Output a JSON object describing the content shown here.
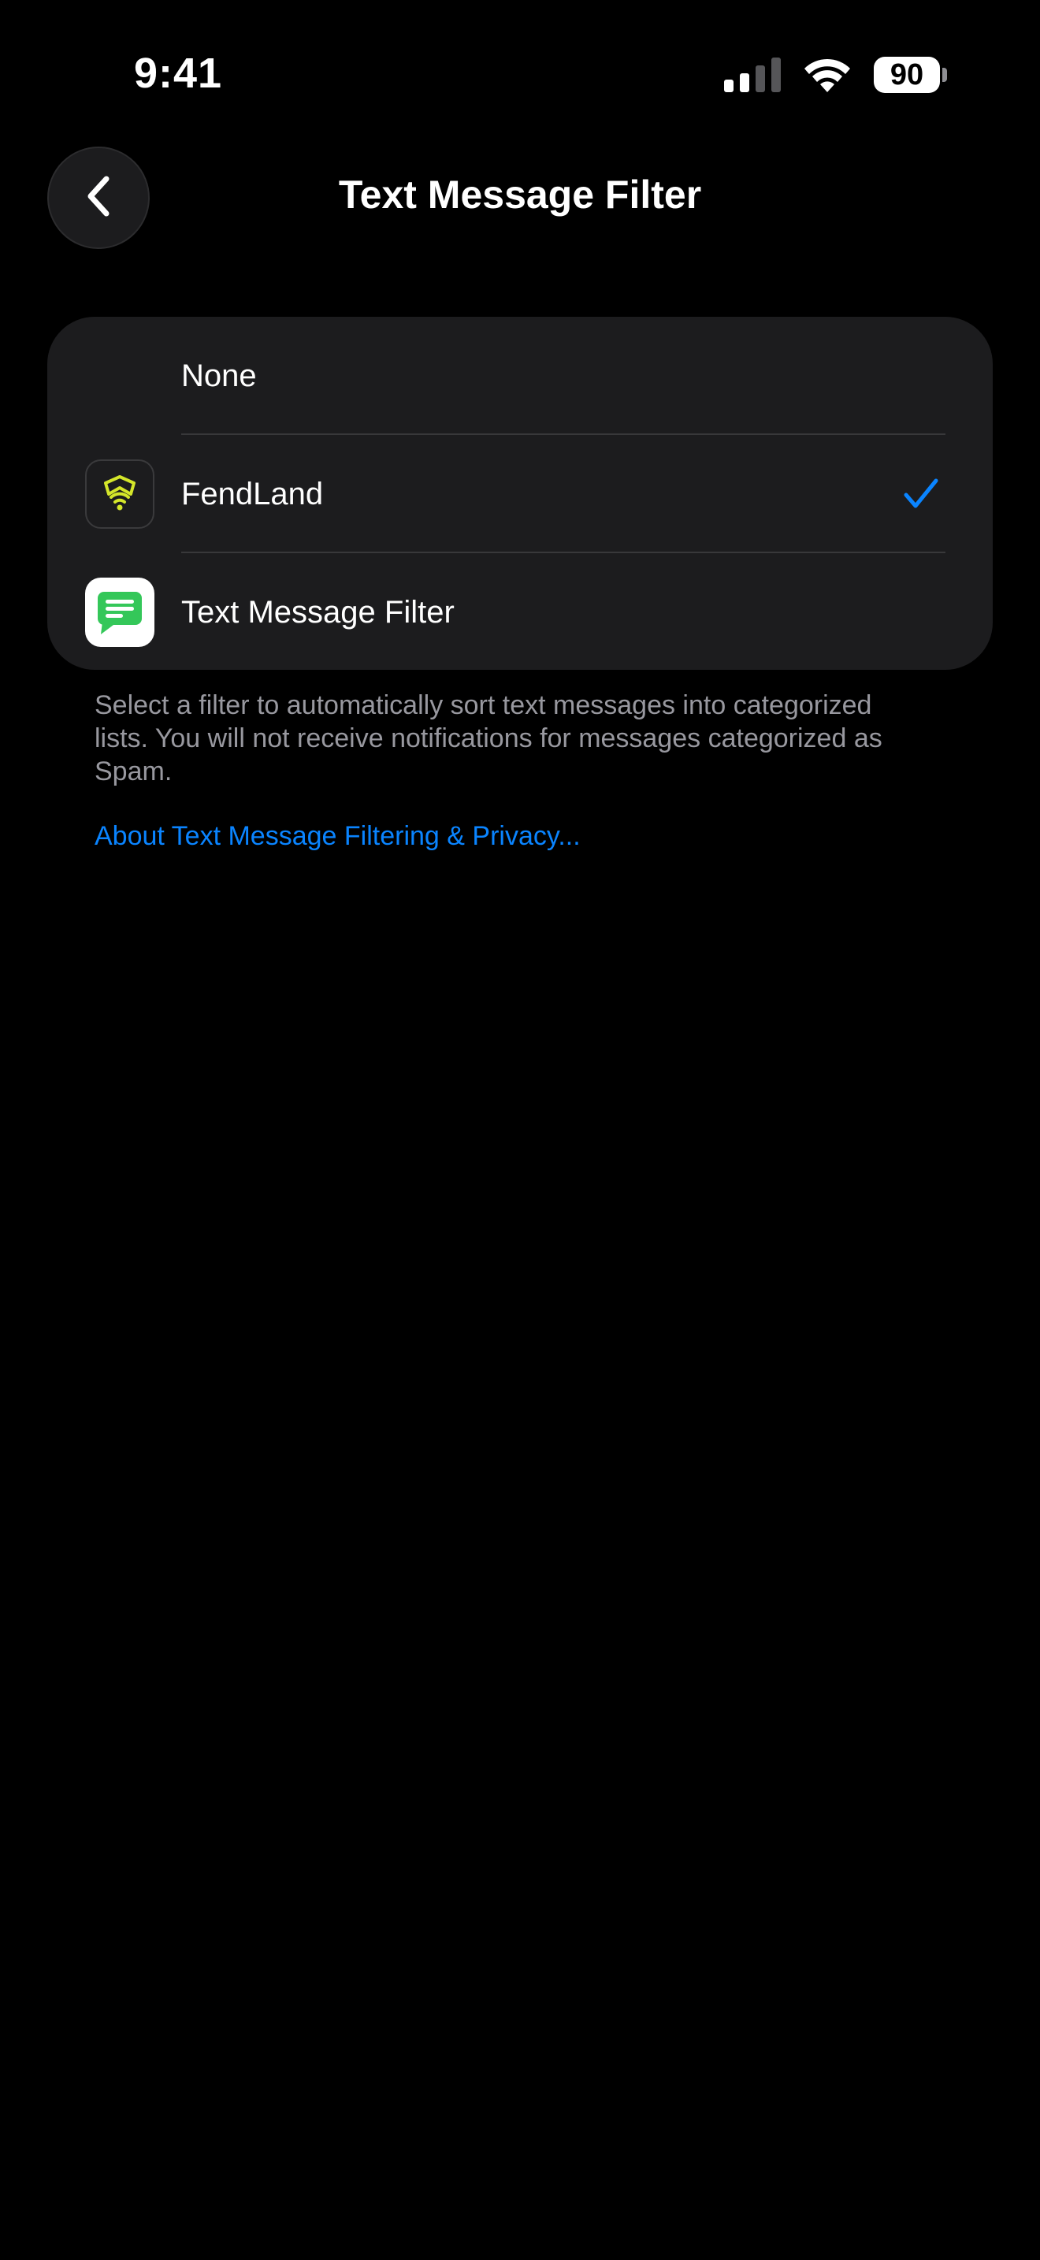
{
  "status_bar": {
    "time": "9:41",
    "battery_level": "90",
    "icons": [
      "cellular-signal-icon",
      "wifi-icon",
      "battery-icon"
    ]
  },
  "nav": {
    "back_icon": "chevron-left-icon",
    "title": "Text Message Filter"
  },
  "options": [
    {
      "label": "None",
      "icon": null,
      "selected": false
    },
    {
      "label": "FendLand",
      "icon": "fendland-shield-icon",
      "selected": true
    },
    {
      "label": "Text Message Filter",
      "icon": "chat-bubble-icon",
      "selected": false
    }
  ],
  "footer": {
    "description": "Select a filter to automatically sort text messages into categorized lists. You will not receive notifications for messages categorized as Spam.",
    "link": "About Text Message Filtering & Privacy..."
  },
  "colors": {
    "background": "#000000",
    "card": "#1c1c1e",
    "accent": "#0a84ff",
    "secondary_text": "#98989f",
    "fendland_brand": "#d4e62a",
    "tmf_brand": "#34c759"
  }
}
